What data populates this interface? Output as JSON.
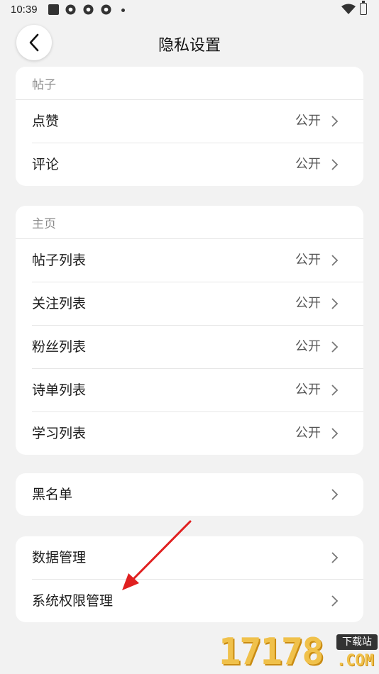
{
  "status_bar": {
    "time": "10:39"
  },
  "header": {
    "title": "隐私设置"
  },
  "sections": {
    "posts": {
      "label": "帖子",
      "rows": [
        {
          "label": "点赞",
          "value": "公开"
        },
        {
          "label": "评论",
          "value": "公开"
        }
      ]
    },
    "homepage": {
      "label": "主页",
      "rows": [
        {
          "label": "帖子列表",
          "value": "公开"
        },
        {
          "label": "关注列表",
          "value": "公开"
        },
        {
          "label": "粉丝列表",
          "value": "公开"
        },
        {
          "label": "诗单列表",
          "value": "公开"
        },
        {
          "label": "学习列表",
          "value": "公开"
        }
      ]
    },
    "blacklist": {
      "rows": [
        {
          "label": "黑名单"
        }
      ]
    },
    "management": {
      "rows": [
        {
          "label": "数据管理"
        },
        {
          "label": "系统权限管理"
        }
      ]
    }
  },
  "watermark": {
    "number": "17178",
    "tag": "下载站",
    "domain": ".COM"
  },
  "colors": {
    "background": "#f2f2f2",
    "card": "#ffffff",
    "annotation_arrow": "#e02020"
  }
}
